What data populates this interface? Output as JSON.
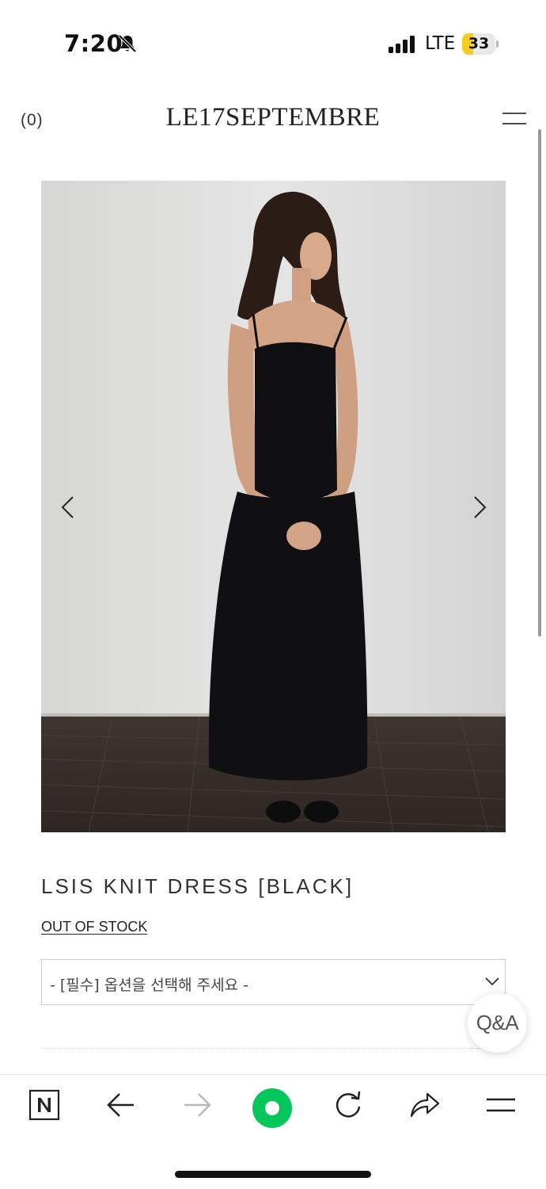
{
  "status_bar": {
    "time": "7:20",
    "network": "LTE",
    "battery_level": "33",
    "battery_fraction": 0.33,
    "battery_color": "#f5cc20",
    "icons": [
      "bell-slash-icon",
      "signal-icon",
      "battery-icon"
    ]
  },
  "header": {
    "cart_count": "(0)",
    "brand": "LE17SEPTEMBRE",
    "menu_icon": "menu-icon"
  },
  "product": {
    "image_icons": [
      "chevron-left-icon",
      "chevron-right-icon"
    ],
    "name": "LSIS KNIT DRESS [BLACK]",
    "stock_status": "OUT OF STOCK",
    "option_select": {
      "placeholder": "- [필수] 옵션을 선택해 주세요 -",
      "icon": "chevron-down-icon"
    }
  },
  "qa_button": {
    "label": "Q&A"
  },
  "browser_toolbar": {
    "buttons": [
      "naver-home-icon",
      "back-arrow-icon",
      "forward-arrow-icon",
      "green-dot-icon",
      "reload-icon",
      "share-icon",
      "hamburger-menu-icon"
    ],
    "accent_color": "#03c75a"
  }
}
